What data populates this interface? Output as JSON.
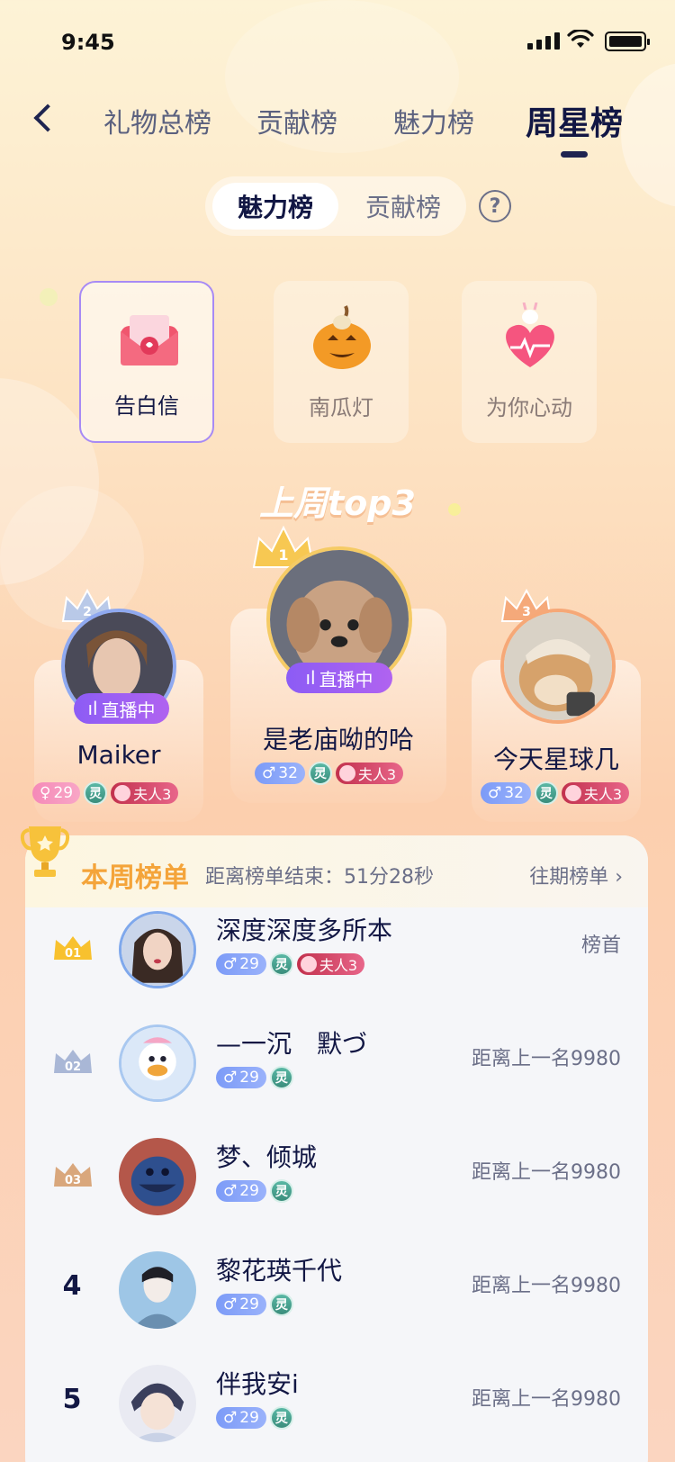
{
  "status_bar": {
    "time": "9:45"
  },
  "nav": {
    "tabs": [
      {
        "label": "礼物总榜"
      },
      {
        "label": "贡献榜"
      },
      {
        "label": "魅力榜"
      },
      {
        "label": "周星榜"
      }
    ]
  },
  "segment": {
    "active": "魅力榜",
    "inactive": "贡献榜",
    "help": "?"
  },
  "gifts": [
    {
      "label": "告白信",
      "selected": true
    },
    {
      "label": "南瓜灯"
    },
    {
      "label": "为你心动"
    }
  ],
  "top3": {
    "title": "上周top3",
    "live_label": "直播中",
    "first": {
      "rank": "1",
      "name": "是老庙呦的哈",
      "gender": "♂",
      "age": "32",
      "level": "灵",
      "title_badge": "夫人3",
      "live": true
    },
    "second": {
      "rank": "2",
      "name": "Maiker",
      "gender": "♀",
      "age": "29",
      "level": "灵",
      "title_badge": "夫人3",
      "live": true
    },
    "third": {
      "rank": "3",
      "name": "今天星球几",
      "gender": "♂",
      "age": "32",
      "level": "灵",
      "title_badge": "夫人3",
      "live": false
    }
  },
  "weekly": {
    "title": "本周榜单",
    "countdown": "距离榜单结束：51分28秒",
    "history": "往期榜单 ›",
    "rows": [
      {
        "rank": "01",
        "name": "深度深度多所本",
        "gender": "♂",
        "age": "29",
        "level": "灵",
        "title_badge": "夫人3",
        "tail": "榜首"
      },
      {
        "rank": "02",
        "name": "—一沉　默づ",
        "gender": "♂",
        "age": "29",
        "level": "灵",
        "tail": "距离上一名9980"
      },
      {
        "rank": "03",
        "name": "梦、倾城",
        "gender": "♂",
        "age": "29",
        "level": "灵",
        "tail": "距离上一名9980"
      },
      {
        "rank": "4",
        "name": "黎花瑛千代",
        "gender": "♂",
        "age": "29",
        "level": "灵",
        "tail": "距离上一名9980"
      },
      {
        "rank": "5",
        "name": "伴我安i",
        "gender": "♂",
        "age": "29",
        "level": "灵",
        "tail": "距离上一名9980"
      }
    ]
  },
  "colors": {
    "accent_purple": "#9a5ff2",
    "gold": "#f4a43a",
    "male_chip": "#8aa7f9",
    "female_chip": "#f598c0"
  }
}
